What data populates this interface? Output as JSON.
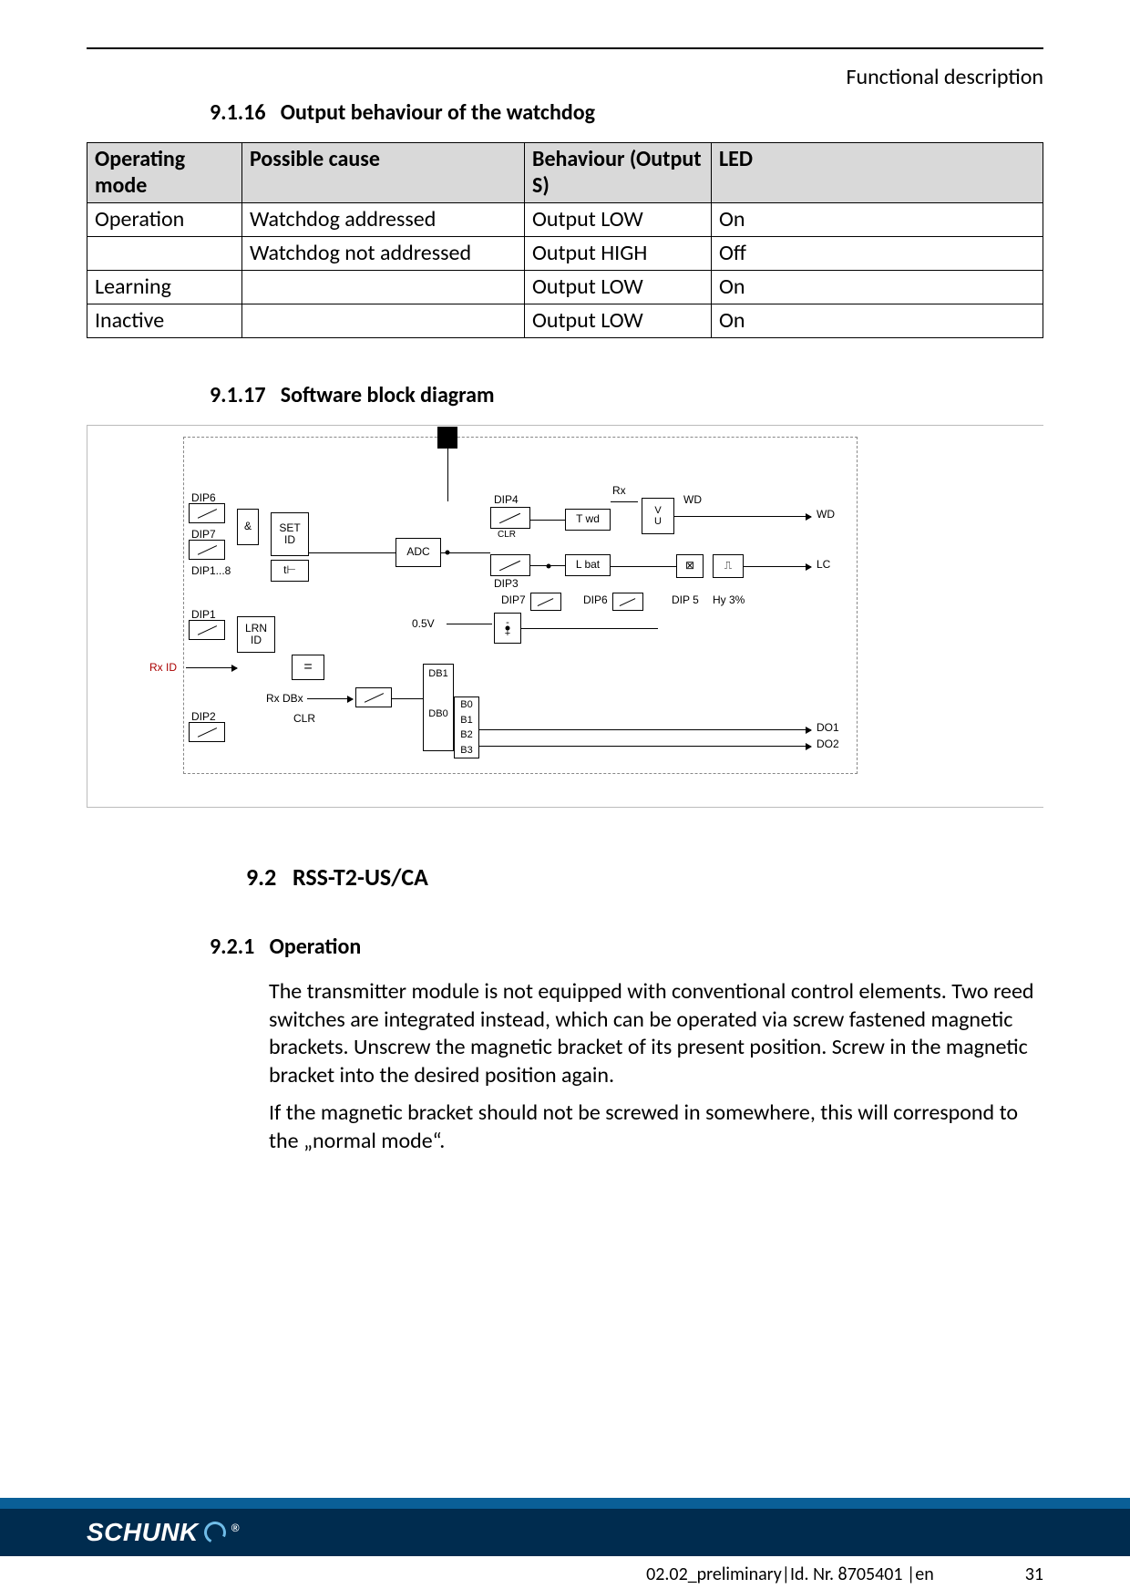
{
  "header": {
    "section": "Functional description"
  },
  "headings": {
    "h9116_num": "9.1.16",
    "h9116_title": "Output behaviour of the watchdog",
    "h9117_num": "9.1.17",
    "h9117_title": "Software block diagram",
    "h92_num": "9.2",
    "h92_title": "RSS-T2-US/CA",
    "h921_num": "9.2.1",
    "h921_title": "Operation"
  },
  "table": {
    "headers": {
      "mode": "Operating mode",
      "cause": "Possible cause",
      "behaviour": "Behaviour (Output S)",
      "led": "LED"
    },
    "rows": [
      {
        "mode": "Operation",
        "cause": "Watchdog addressed",
        "behaviour": "Output LOW",
        "led": "On"
      },
      {
        "mode": "",
        "cause": "Watchdog not addressed",
        "behaviour": "Output HIGH",
        "led": "Off"
      },
      {
        "mode": "Learning",
        "cause": "",
        "behaviour": "Output LOW",
        "led": "On"
      },
      {
        "mode": "Inactive",
        "cause": "",
        "behaviour": "Output LOW",
        "led": "On"
      }
    ]
  },
  "diagram": {
    "labels": {
      "dip6": "DIP6",
      "dip7": "DIP7",
      "dip1_8": "DIP1...8",
      "dip1": "DIP1",
      "dip2": "DIP2",
      "dip3": "DIP3",
      "dip4": "DIP4",
      "dip5": "DIP 5",
      "dip6r": "DIP6",
      "dip7r": "DIP7",
      "set_id": "SET\nID",
      "lrn_id": "LRN\nID",
      "eq": "=",
      "adc": "ADC",
      "clr": "CLR",
      "clr2": "CLR",
      "rx": "Rx",
      "rx_id": "Rx ID",
      "rx_dbx": "Rx DBx",
      "twd": "T wd",
      "lbat": "L bat",
      "hy": "Hy 3%",
      "db0": "DB0",
      "db1": "DB1",
      "b0": "B0",
      "b1": "B1",
      "b2": "B2",
      "b3": "B3",
      "half_v": "0.5V",
      "amp": "&",
      "plus": "+",
      "minus": "-",
      "out_wd": "WD",
      "out_wd2": "WD",
      "out_lc": "LC",
      "out_do1": "DO1",
      "out_do2": "DO2",
      "v": "V",
      "u": "U",
      "t": "t"
    }
  },
  "body": {
    "p1": "The transmitter module is not equipped with conventional control elements. Two reed switches are integrated instead, which can be operated via screw fastened magnetic brackets. Unscrew the magnetic bracket of its present position. Screw in the magnetic bracket into the desired position again.",
    "p2": "If the magnetic bracket should not be screwed in somewhere, this will correspond to the „normal mode“."
  },
  "footer": {
    "logo": "SCHUNK",
    "meta": "02.02_preliminary|Id. Nr. 8705401 |en",
    "page": "31"
  }
}
